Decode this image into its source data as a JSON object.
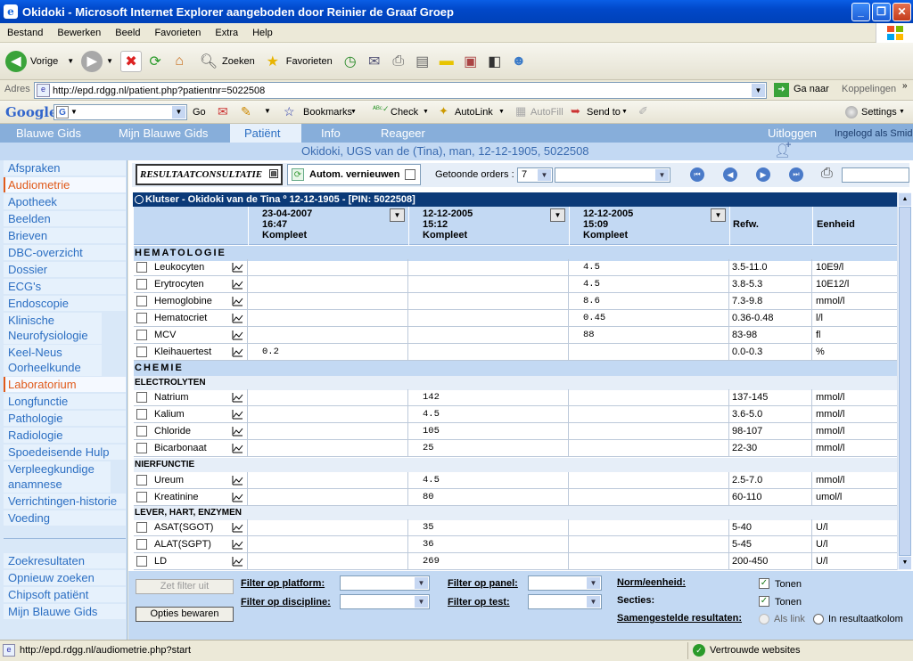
{
  "window": {
    "title": "Okidoki - Microsoft Internet Explorer aangeboden door Reinier de Graaf Groep"
  },
  "menu": [
    "Bestand",
    "Bewerken",
    "Beeld",
    "Favorieten",
    "Extra",
    "Help"
  ],
  "toolbar": {
    "back": "Vorige",
    "search": "Zoeken",
    "favorites": "Favorieten"
  },
  "address": {
    "label": "Adres",
    "url": "http://epd.rdgg.nl/patient.php?patientnr=5022508",
    "go": "Ga naar",
    "links": "Koppelingen"
  },
  "googlebar": {
    "logo": "Google",
    "go": "Go",
    "bookmarks": "Bookmarks",
    "check": "Check",
    "autolink": "AutoLink",
    "autofill": "AutoFill",
    "sendto": "Send to",
    "settings": "Settings"
  },
  "appnav": {
    "tabs": [
      "Blauwe Gids",
      "Mijn Blauwe Gids",
      "Patiënt",
      "Info",
      "Reageer"
    ],
    "logout": "Uitloggen",
    "loggedin": "Ingelogd als Smid",
    "patient": "Okidoki, UGS van de (Tina), man, 12-12-1905, 5022508"
  },
  "sidebar": {
    "items": [
      "Afspraken",
      "Audiometrie",
      "Apotheek",
      "Beelden",
      "Brieven",
      "DBC-overzicht",
      "Dossier",
      "ECG's",
      "Endoscopie",
      "Klinische Neurofysiologie",
      "Keel-Neus Oorheelkunde",
      "Laboratorium",
      "Longfunctie",
      "Pathologie",
      "Radiologie",
      "Spoedeisende Hulp",
      "Verpleegkundige anamnese",
      "Verrichtingen-historie",
      "Voeding"
    ],
    "bottom": [
      "Zoekresultaten",
      "Opnieuw zoeken",
      "Chipsoft patiënt",
      "Mijn Blauwe Gids"
    ]
  },
  "ctoolbar": {
    "title": "RESULTAATCONSULTATIE",
    "refresh": "Autom. vernieuwen",
    "orders_label": "Getoonde orders :",
    "orders_value": "7"
  },
  "patientbar": "Klutser - Okidoki van de Tina  º 12-12-1905 - [PIN: 5022508]",
  "columns": [
    {
      "date": "23-04-2007",
      "time": "16:47",
      "status": "Kompleet"
    },
    {
      "date": "12-12-2005",
      "time": "15:12",
      "status": "Kompleet"
    },
    {
      "date": "12-12-2005",
      "time": "15:09",
      "status": "Kompleet"
    }
  ],
  "col_ref": "Refw.",
  "col_unit": "Eenheid",
  "sections": {
    "hematologie": "HEMATOLOGIE",
    "chemie": "CHEMIE",
    "electrolyten": "ELECTROLYTEN",
    "nierfunctie": "NIERFUNCTIE",
    "lever": "LEVER, HART, ENZYMEN"
  },
  "hematologie": [
    {
      "name": "Leukocyten",
      "v1": "",
      "v2": "",
      "v3": "4.5",
      "ref": "3.5-11.0",
      "unit": "10E9/l"
    },
    {
      "name": "Erytrocyten",
      "v1": "",
      "v2": "",
      "v3": "4.5",
      "ref": "3.8-5.3",
      "unit": "10E12/l"
    },
    {
      "name": "Hemoglobine",
      "v1": "",
      "v2": "",
      "v3": "8.6",
      "ref": "7.3-9.8",
      "unit": "mmol/l"
    },
    {
      "name": "Hematocriet",
      "v1": "",
      "v2": "",
      "v3": "0.45",
      "ref": "0.36-0.48",
      "unit": "l/l"
    },
    {
      "name": "MCV",
      "v1": "",
      "v2": "",
      "v3": "88",
      "ref": "83-98",
      "unit": "fl"
    },
    {
      "name": "Kleihauertest",
      "v1": "0.2",
      "v2": "",
      "v3": "",
      "ref": "0.0-0.3",
      "unit": "%"
    }
  ],
  "electrolyten": [
    {
      "name": "Natrium",
      "v1": "",
      "v2": "142",
      "v3": "",
      "ref": "137-145",
      "unit": "mmol/l"
    },
    {
      "name": "Kalium",
      "v1": "",
      "v2": "4.5",
      "v3": "",
      "ref": "3.6-5.0",
      "unit": "mmol/l"
    },
    {
      "name": "Chloride",
      "v1": "",
      "v2": "105",
      "v3": "",
      "ref": "98-107",
      "unit": "mmol/l"
    },
    {
      "name": "Bicarbonaat",
      "v1": "",
      "v2": "25",
      "v3": "",
      "ref": "22-30",
      "unit": "mmol/l"
    }
  ],
  "nierfunctie": [
    {
      "name": "Ureum",
      "v1": "",
      "v2": "4.5",
      "v3": "",
      "ref": "2.5-7.0",
      "unit": "mmol/l"
    },
    {
      "name": "Kreatinine",
      "v1": "",
      "v2": "80",
      "v3": "",
      "ref": "60-110",
      "unit": "umol/l"
    }
  ],
  "lever": [
    {
      "name": "ASAT(SGOT)",
      "v1": "",
      "v2": "35",
      "v3": "",
      "ref": "5-40",
      "unit": "U/l"
    },
    {
      "name": "ALAT(SGPT)",
      "v1": "",
      "v2": "36",
      "v3": "",
      "ref": "5-45",
      "unit": "U/l"
    },
    {
      "name": "LD",
      "v1": "",
      "v2": "269",
      "v3": "",
      "ref": "200-450",
      "unit": "U/l"
    }
  ],
  "filters": {
    "set_filter": "Zet filter uit",
    "save": "Opties bewaren",
    "platform": "Filter op platform:",
    "discipline": "Filter op discipline:",
    "panel": "Filter op panel:",
    "test": "Filter op test:",
    "norm": "Norm/eenheid:",
    "secties": "Secties:",
    "samengesteld": "Samengestelde resultaten:",
    "tonen1": "Tonen",
    "tonen2": "Tonen",
    "alslink": "Als link",
    "inkolom": "In resultaatkolom"
  },
  "status": {
    "url": "http://epd.rdgg.nl/audiometrie.php?start",
    "zone": "Vertrouwde websites"
  }
}
